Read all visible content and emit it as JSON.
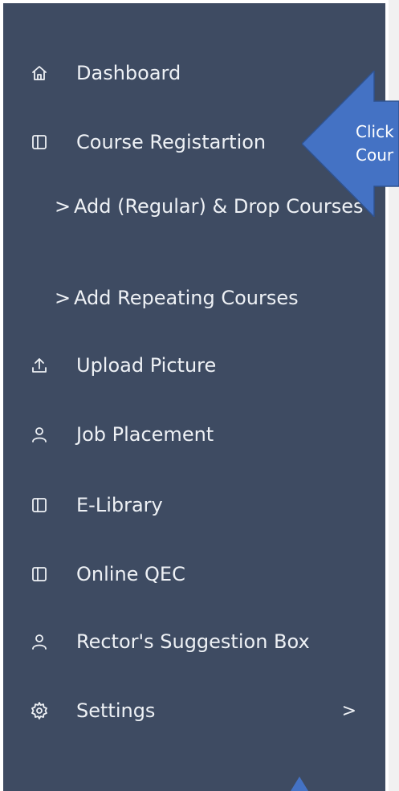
{
  "sidebar": {
    "items": [
      {
        "label": "Dashboard",
        "icon": "home-icon"
      },
      {
        "label": "Course Registartion",
        "icon": "panel-icon"
      },
      {
        "label": "Upload Picture",
        "icon": "upload-icon"
      },
      {
        "label": "Job Placement",
        "icon": "user-icon"
      },
      {
        "label": "E-Library",
        "icon": "panel-icon"
      },
      {
        "label": "Online QEC",
        "icon": "panel-icon"
      },
      {
        "label": "Rector's Suggestion Box",
        "icon": "user-icon"
      },
      {
        "label": "Settings",
        "icon": "gear-icon"
      }
    ],
    "subitems": [
      {
        "chevron": ">",
        "label": "Add (Regular) & Drop Courses"
      },
      {
        "chevron": ">",
        "label": "Add Repeating Courses"
      }
    ],
    "settings_chevron": ">"
  },
  "callout": {
    "line1": "Click",
    "line2": "Cour",
    "color": "#4472c4"
  },
  "colors": {
    "sidebar_bg": "#3e4b62",
    "text": "#eef1f5"
  }
}
